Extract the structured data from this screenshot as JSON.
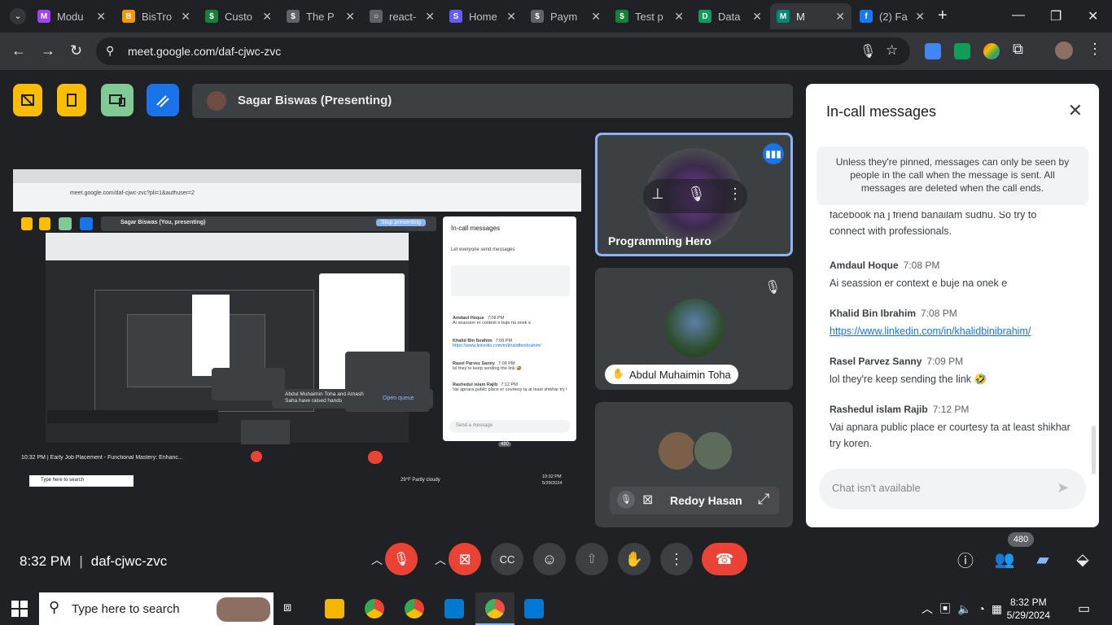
{
  "browser": {
    "tabs": [
      {
        "label": "Modu",
        "color": "#a142f4",
        "glyph": "M"
      },
      {
        "label": "BisTro",
        "color": "#f29900",
        "glyph": "B"
      },
      {
        "label": "Custo",
        "color": "#188038",
        "glyph": "$"
      },
      {
        "label": "The P",
        "color": "#5f6368",
        "glyph": "$"
      },
      {
        "label": "react-",
        "color": "#5f6368",
        "glyph": "○"
      },
      {
        "label": "Home",
        "color": "#635bff",
        "glyph": "S"
      },
      {
        "label": "Paym",
        "color": "#5f6368",
        "glyph": "$"
      },
      {
        "label": "Test p",
        "color": "#188038",
        "glyph": "$"
      },
      {
        "label": "Data",
        "color": "#0f9d58",
        "glyph": "D"
      },
      {
        "label": "M",
        "color": "#00897b",
        "glyph": "M"
      },
      {
        "label": "(2) Fa",
        "color": "#1877f2",
        "glyph": "f"
      }
    ],
    "url": "meet.google.com/daf-cjwc-zvc"
  },
  "meet": {
    "presenter_label": "Sagar Biswas (Presenting)",
    "tiles": [
      {
        "name": "Programming Hero"
      },
      {
        "name": "Abdul Muhaimin Toha"
      },
      {
        "name": "Redoy Hasan"
      }
    ],
    "time": "8:32 PM",
    "meeting_code": "daf-cjwc-zvc",
    "participant_count": "480"
  },
  "chat": {
    "title": "In-call messages",
    "notice": "Unless they're pinned, messages can only be seen by people in the call when the message is sent. All messages are deleted when the call ends.",
    "partial_message": "facebook na j friend banailam sudhu. So try to connect with professionals.",
    "messages": [
      {
        "sender": "Amdaul Hoque",
        "time": "7:08 PM",
        "text": "Ai seassion er context e buje na onek e"
      },
      {
        "sender": "Khalid Bin Ibrahim",
        "time": "7:08 PM",
        "text": "https://www.linkedin.com/in/khalidbinibrahim/"
      },
      {
        "sender": "Rasel Parvez Sanny",
        "time": "7:09 PM",
        "text": "lol they're keep sending the link 🤣"
      },
      {
        "sender": "Rashedul islam Rajib",
        "time": "7:12 PM",
        "text": "Vai apnara public place er courtesy ta at least shikhar try koren."
      }
    ],
    "input_placeholder": "Chat isn't available"
  },
  "share": {
    "inner_title": "Sagar Biswas (You, presenting)",
    "stop_label": "Stop presenting",
    "inner_chat_title": "In-call messages",
    "inner_toggle": "Let everyone send messages",
    "inner_url": "meet.google.com/daf-cjwc-zvc?pli=1&authuser=2",
    "inner_raised": "Abdul Muhaimin Toha and Amash Saha have raised hands",
    "inner_queue": "Open queue",
    "inner_bottom": "10:32 PM  |  Early Job Placement - Functional Mastery: Enhanc...",
    "inner_input": "Send a message",
    "inner_search": "Type here to search",
    "inner_weather": "29°F  Partly cloudy",
    "inner_clock_time": "10:32 PM",
    "inner_clock_date": "5/29/2024",
    "inner_badge": "480",
    "inner_messages": [
      {
        "sender": "Amdaul Hoque",
        "time": "7:08 PM",
        "text": "Ai seassion er context e buje na onek e"
      },
      {
        "sender": "Khalid Bin Ibrahim",
        "time": "7:08 PM",
        "text": "https://www.linkedin.com/in/khalidbinibrahim/"
      },
      {
        "sender": "Rasel Parvez Sanny",
        "time": "7:09 PM",
        "text": "lol they're keep sending the link 🤣"
      },
      {
        "sender": "Rashedul islam Rajib",
        "time": "7:12 PM",
        "text": "Vai apnara public place er courtesy ta at least shikhar try koren."
      }
    ]
  },
  "taskbar": {
    "search_placeholder": "Type here to search",
    "time": "8:32 PM",
    "date": "5/29/2024"
  }
}
